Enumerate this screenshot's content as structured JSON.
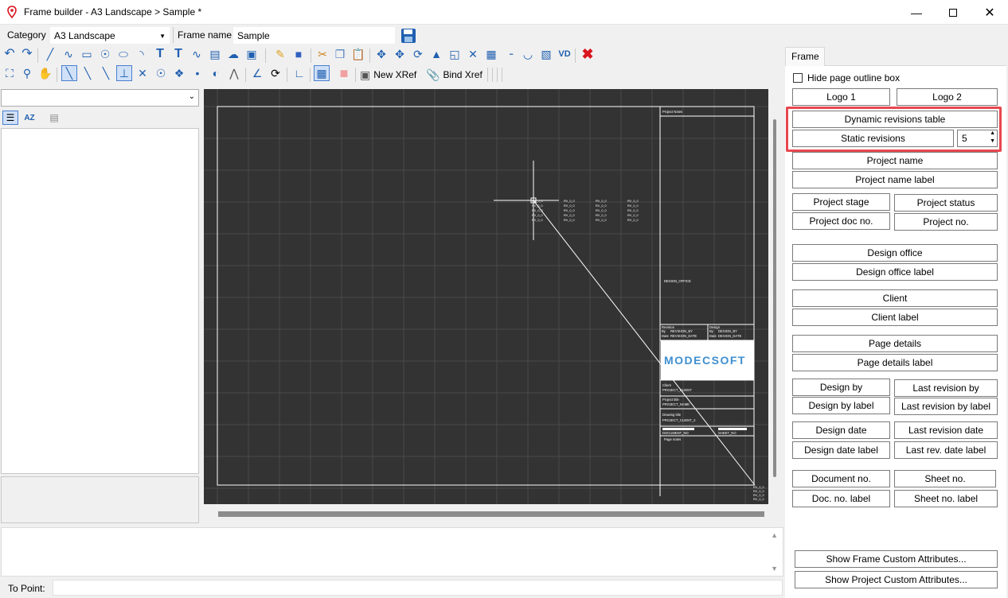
{
  "window": {
    "title": "Frame builder - A3 Landscape > Sample *"
  },
  "toolbar_top": {
    "category_label": "Category",
    "category_value": "A3 Landscape",
    "frame_name_label": "Frame name",
    "frame_name_value": "Sample"
  },
  "toolbar2": {
    "new_xref": "New XRef",
    "bind_xref": "Bind Xref"
  },
  "command": {
    "to_point_label": "To Point:"
  },
  "right_panel": {
    "tab": "Frame",
    "hide_outline": "Hide page outline box",
    "logo1": "Logo 1",
    "logo2": "Logo 2",
    "dyn_rev": "Dynamic revisions table",
    "static_rev": "Static revisions",
    "static_rev_count": "5",
    "project_name": "Project name",
    "project_name_label": "Project name label",
    "project_stage": "Project stage",
    "project_status": "Project status",
    "project_doc_no": "Project doc no.",
    "project_no": "Project no.",
    "design_office": "Design office",
    "design_office_label": "Design office label",
    "client": "Client",
    "client_label": "Client label",
    "page_details": "Page details",
    "page_details_label": "Page details label",
    "design_by": "Design by",
    "last_revision_by": "Last revision by",
    "design_by_label": "Design by label",
    "last_revision_by_label": "Last revision by label",
    "design_date": "Design date",
    "last_revision_date": "Last revision date",
    "design_date_label": "Design date label",
    "last_rev_date_label": "Last rev. date label",
    "document_no": "Document no.",
    "sheet_no": "Sheet no.",
    "doc_no_label": "Doc. no. label",
    "sheet_no_label": "Sheet no. label",
    "show_frame_attrs": "Show Frame Custom Attributes...",
    "show_project_attrs": "Show Project Custom Attributes..."
  },
  "canvas": {
    "project_notes": "Project Notes",
    "design_office_field": "DESIGN_OFFICE",
    "revision_hdr": "Revision",
    "by": "By",
    "date": "Date",
    "revision_by": "REVISION_BY",
    "revision_date": "REVISION_DATE",
    "design_hdr": "Design",
    "design_by_field": "DESIGN_BY",
    "design_date_field": "DESIGN_DATE",
    "logo_text": "MODECSOFT",
    "client_hdr": "Client",
    "project_client": "PROJECT_CLIENT",
    "project_title_hdr": "Project title",
    "project_name_field": "PROJECT_NAME",
    "drawing_title_hdr": "Drawing title",
    "project_client2": "PROJECT_CLIENT_2",
    "document_no_field": "DOCUMENT_NO",
    "sheet_no_field": "SHEET_NO",
    "page_notes": "Page notes",
    "rev_cell": "RV_0_0"
  },
  "colors": {
    "canvas_bg": "#333333",
    "grid": "#4a4a4a",
    "highlight": "#e8474f",
    "logo_text": "#3f8fd0",
    "delete_red": "#d9141e"
  }
}
